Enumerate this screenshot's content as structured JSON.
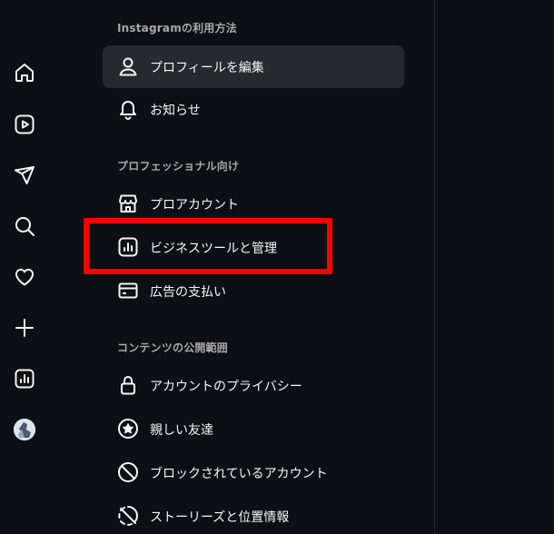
{
  "sidebar": {
    "icons": [
      {
        "name": "home-icon"
      },
      {
        "name": "reels-icon"
      },
      {
        "name": "messages-icon"
      },
      {
        "name": "search-icon"
      },
      {
        "name": "notifications-icon"
      },
      {
        "name": "create-icon"
      },
      {
        "name": "dashboard-icon"
      },
      {
        "name": "profile-avatar"
      }
    ]
  },
  "settings": {
    "sections": [
      {
        "title": "Instagramの利用方法",
        "items": [
          {
            "label": "プロフィールを編集",
            "icon": "profile-icon",
            "active": true
          },
          {
            "label": "お知らせ",
            "icon": "bell-icon",
            "active": false
          }
        ]
      },
      {
        "title": "プロフェッショナル向け",
        "items": [
          {
            "label": "プロアカウント",
            "icon": "shop-icon",
            "active": false
          },
          {
            "label": "ビジネスツールと管理",
            "icon": "insights-icon",
            "active": false,
            "highlighted": true
          },
          {
            "label": "広告の支払い",
            "icon": "card-icon",
            "active": false
          }
        ]
      },
      {
        "title": "コンテンツの公開範囲",
        "items": [
          {
            "label": "アカウントのプライバシー",
            "icon": "lock-icon",
            "active": false
          },
          {
            "label": "親しい友達",
            "icon": "star-circle-icon",
            "active": false
          },
          {
            "label": "ブロックされているアカウント",
            "icon": "block-icon",
            "active": false
          },
          {
            "label": "ストーリーズと位置情報",
            "icon": "story-location-icon",
            "active": false
          }
        ]
      }
    ]
  },
  "colors": {
    "background": "#0c1014",
    "active_item": "#262a2e",
    "section_title": "#a8a8a8",
    "highlight": "#ff0000"
  }
}
